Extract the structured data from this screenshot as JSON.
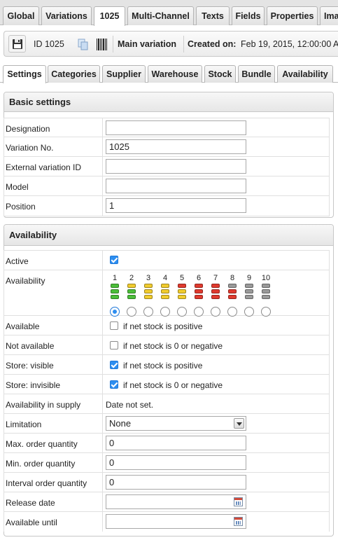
{
  "top_tabs": [
    {
      "label": "Global"
    },
    {
      "label": "Variations"
    },
    {
      "label": "1025"
    },
    {
      "label": "Multi-Channel"
    },
    {
      "label": "Texts"
    },
    {
      "label": "Fields"
    },
    {
      "label": "Properties"
    },
    {
      "label": "Ima"
    }
  ],
  "toolbar": {
    "save_icon": "floppy-disk-icon",
    "id_text": "ID 1025",
    "copy_icon": "copy-icon",
    "barcode_icon": "barcode-icon",
    "variation_label": "Main variation",
    "created_label": "Created on:",
    "created_value": "Feb 19, 2015, 12:00:00 A"
  },
  "sub_tabs": [
    {
      "label": "Settings"
    },
    {
      "label": "Categories"
    },
    {
      "label": "Supplier"
    },
    {
      "label": "Warehouse"
    },
    {
      "label": "Stock"
    },
    {
      "label": "Bundle"
    },
    {
      "label": "Availability"
    }
  ],
  "basic_settings": {
    "title": "Basic settings",
    "fields": [
      {
        "label": "Designation",
        "value": ""
      },
      {
        "label": "Variation No.",
        "value": "1025"
      },
      {
        "label": "External variation ID",
        "value": ""
      },
      {
        "label": "Model",
        "value": ""
      },
      {
        "label": "Position",
        "value": "1"
      }
    ]
  },
  "availability": {
    "title": "Availability",
    "active_label": "Active",
    "active_checked": true,
    "availability_label": "Availability",
    "levels": [
      {
        "num": "1",
        "color": "#4cbf3a",
        "bars": 3,
        "selected": true
      },
      {
        "num": "2",
        "color": "#4cbf3a",
        "bars": 3,
        "top_color": "#f1cc2e",
        "selected": false
      },
      {
        "num": "3",
        "color": "#f1cc2e",
        "bars": 3,
        "selected": false
      },
      {
        "num": "4",
        "color": "#f1cc2e",
        "bars": 3,
        "selected": false
      },
      {
        "num": "5",
        "color": "#f1cc2e",
        "bars": 3,
        "top_color": "#e03a2e",
        "selected": false
      },
      {
        "num": "6",
        "color": "#e03a2e",
        "bars": 3,
        "selected": false
      },
      {
        "num": "7",
        "color": "#e03a2e",
        "bars": 3,
        "selected": false
      },
      {
        "num": "8",
        "color": "#e03a2e",
        "bars": 3,
        "top_color": "#9a9a9a",
        "selected": false
      },
      {
        "num": "9",
        "color": "#9a9a9a",
        "bars": 3,
        "selected": false
      },
      {
        "num": "10",
        "color": "#9a9a9a",
        "bars": 3,
        "selected": false
      }
    ],
    "rules": [
      {
        "label": "Available",
        "text": "if net stock is positive",
        "checked": false
      },
      {
        "label": "Not available",
        "text": "if net stock is 0 or negative",
        "checked": false
      },
      {
        "label": "Store: visible",
        "text": "if net stock is positive",
        "checked": true
      },
      {
        "label": "Store: invisible",
        "text": "if net stock is 0 or negative",
        "checked": true
      }
    ],
    "supply_label": "Availability in supply",
    "supply_value": "Date not set.",
    "limitation_label": "Limitation",
    "limitation_value": "None",
    "quantities": [
      {
        "label": "Max. order quantity",
        "value": "0"
      },
      {
        "label": "Min. order quantity",
        "value": "0"
      },
      {
        "label": "Interval order quantity",
        "value": "0"
      }
    ],
    "dates": [
      {
        "label": "Release date",
        "value": ""
      },
      {
        "label": "Available until",
        "value": ""
      }
    ]
  }
}
